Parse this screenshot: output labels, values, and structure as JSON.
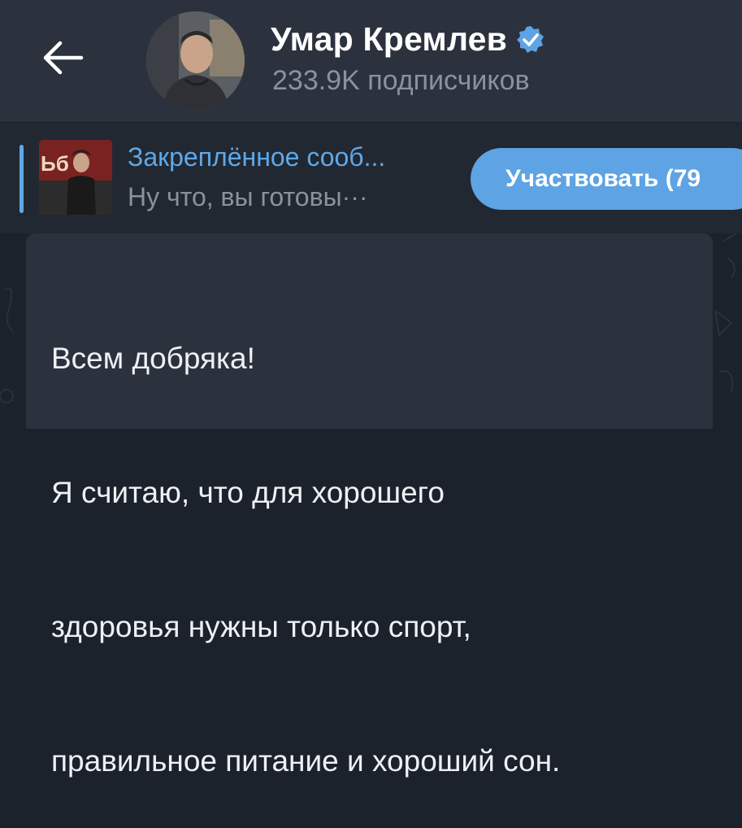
{
  "header": {
    "channel_name": "Умар Кремлев",
    "subscribers": "233.9K подписчиков",
    "back_icon": "arrow-left-icon",
    "verified_icon": "verified-badge-icon",
    "avatar_icon": "avatar-photo"
  },
  "pinned": {
    "title": "Закреплённое сооб...",
    "preview": "Ну что, вы готовы···",
    "join_label": "Участвовать (79",
    "accent_color": "#5fa8e8"
  },
  "message": {
    "lines": [
      "Всем добряка!",
      "Я считаю, что для хорошего",
      "здоровья нужны только спорт,",
      "правильное питание и хороший сон."
    ]
  },
  "colors": {
    "header_bg": "#2b323e",
    "bubble_bg": "#2c323d",
    "button_bg": "#5ea3e3"
  }
}
